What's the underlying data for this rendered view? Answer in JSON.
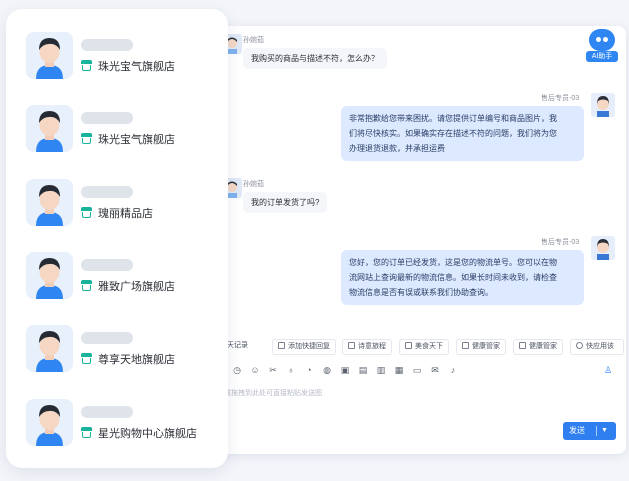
{
  "chat": {
    "messages": [
      {
        "side": "left",
        "sender": "孙婉茹",
        "text": "我购买的商品与描述不符，怎么办？"
      },
      {
        "side": "right",
        "sender": "售后专员-03",
        "lines": [
          "非常抱歉给您带来困扰。请您提供订单编号和商品图片，我",
          "们将尽快核实。如果确实存在描述不符的问题，我们将为您",
          "办理退货退款，并承担运费"
        ]
      },
      {
        "side": "left",
        "sender": "孙婉茹",
        "text": "我的订单发货了吗?"
      },
      {
        "side": "right",
        "sender": "售后专员-03",
        "lines": [
          "您好，您的订单已经发货，这是您的物流单号。您可以在物",
          "流网站上查询最新的物流信息。如果长时间未收到，请检查",
          "物流信息是否有误或联系我们协助查询。"
        ]
      }
    ],
    "ai_helper_label": "AI助手",
    "quick_tabs": [
      "聊天记录",
      "添加快捷回复",
      "诗意旅程",
      "美食天下",
      "健康管家",
      "健康管家",
      "快应用该"
    ],
    "input_placeholder": "或拖拽到此处可直接粘贴发送图",
    "send_label": "发送"
  },
  "shops": [
    {
      "name": "珠光宝气旗舰店"
    },
    {
      "name": "珠光宝气旗舰店"
    },
    {
      "name": "瑰丽精品店"
    },
    {
      "name": "雅致广场旗舰店"
    },
    {
      "name": "尊享天地旗舰店"
    },
    {
      "name": "星光购物中心旗舰店"
    }
  ],
  "colors": {
    "accent": "#2f86f2",
    "shop_icon": "#17b49b",
    "bubble_right": "#dce9ff",
    "bubble_left": "#f4f6fa"
  },
  "icons": {
    "toolbar": [
      "clock-icon",
      "emoji-icon",
      "scissors-icon",
      "microphone-icon",
      "chat-icon",
      "emoji-icon",
      "image-icon",
      "folder-icon",
      "clipboard-icon",
      "document-icon",
      "screen-icon",
      "mail-icon",
      "microphone-icon",
      "user-icon"
    ],
    "shop": "shop-store-icon",
    "send_dropdown": "chevron-down-icon"
  }
}
